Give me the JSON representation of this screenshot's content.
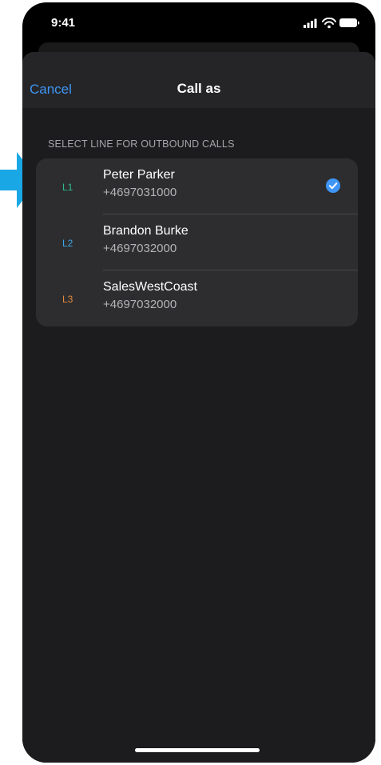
{
  "status_bar": {
    "time": "9:41",
    "icons": [
      "cellular-signal-icon",
      "wifi-icon",
      "battery-icon"
    ]
  },
  "nav": {
    "cancel_label": "Cancel",
    "title": "Call as"
  },
  "section": {
    "header": "SELECT LINE FOR OUTBOUND CALLS"
  },
  "lines": [
    {
      "label": "L1",
      "name": "Peter Parker",
      "number": "+4697031000",
      "color": "#2ebd8a",
      "selected": true
    },
    {
      "label": "L2",
      "name": "Brandon Burke",
      "number": "+4697032000",
      "color": "#3aa7e8",
      "selected": false
    },
    {
      "label": "L3",
      "name": "SalesWestCoast",
      "number": "+4697032000",
      "color": "#e58a3b",
      "selected": false
    }
  ],
  "colors": {
    "accent": "#3e95f5",
    "pointer_arrow": "#1aa7e6",
    "background": "#1c1c1e",
    "card": "#2d2d2f"
  }
}
